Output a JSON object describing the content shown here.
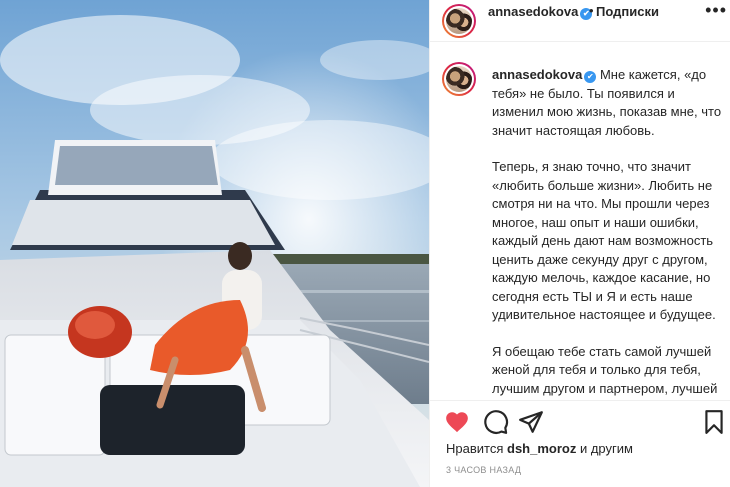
{
  "post": {
    "username": "annasedokova",
    "verified": true,
    "follow_label": "Подписки",
    "dot": "•",
    "more": "•••"
  },
  "caption": {
    "username": "annasedokova",
    "paragraphs": [
      "Мне кажется, «до тебя» не было. Ты появился и изменил мою жизнь, показав мне, что значит настоящая любовь.",
      "Теперь, я знаю точно, что значит «любить больше жизни». Любить не смотря ни на что. Мы прошли через многое, наш опыт и наши ошибки, каждый день дают нам возможность ценить даже секунду друг с другом, каждую мелочь, каждое касание, но сегодня есть ТЫ и Я и есть наше удивительное настоящее и будущее.",
      "Я обещаю тебе стать самой лучшей женой для тебя и только для тебя, лучшим другом и партнером, лучшей мамой нашим детям. Я благодарю Бога за каждую секунду с"
    ]
  },
  "likes": {
    "prefix": "Нравится",
    "user": "dsh_moroz",
    "suffix": "и другим"
  },
  "timestamp": "3 часов назад",
  "icons": {
    "like": "heart-icon",
    "comment": "comment-icon",
    "share": "share-icon",
    "save": "bookmark-icon",
    "verified": "verified-badge-icon"
  },
  "colors": {
    "like_red": "#ed4956",
    "verified_blue": "#3897f0",
    "muted": "#8e8e8e"
  }
}
